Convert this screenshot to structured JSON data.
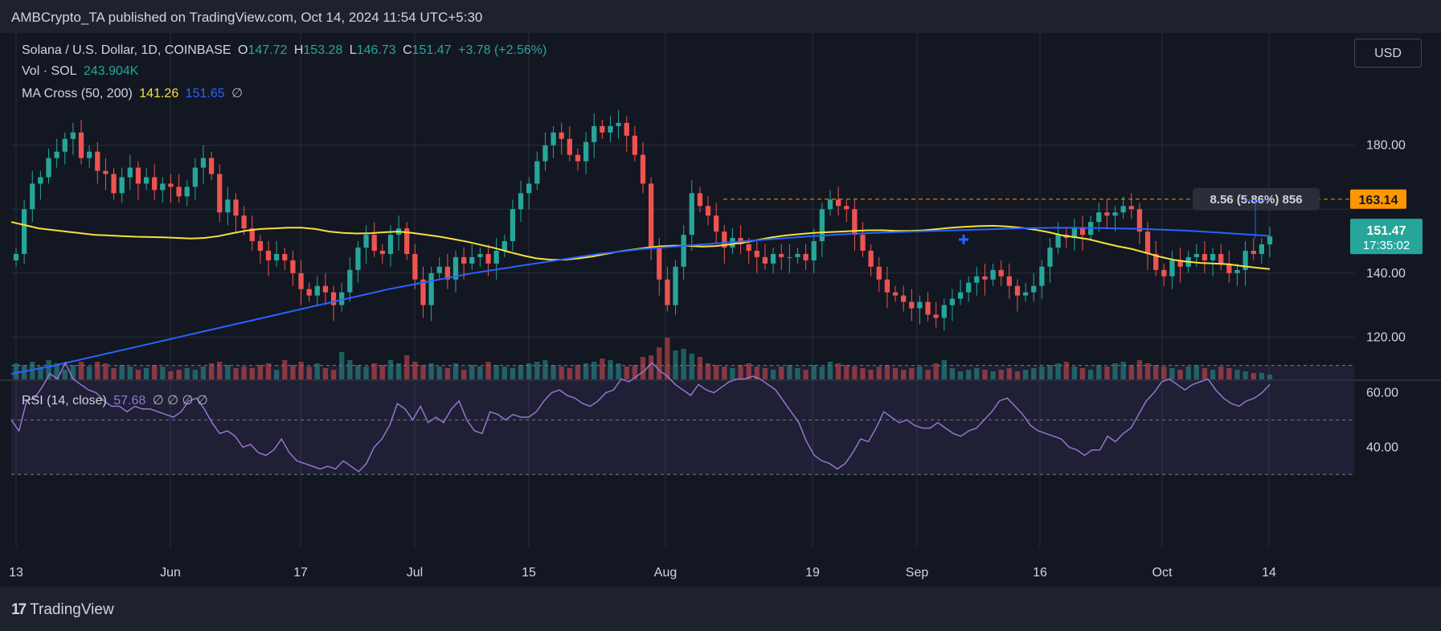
{
  "header": {
    "publish_text": "AMBCrypto_TA published on TradingView.com, Oct 14, 2024 11:54 UTC+5:30"
  },
  "legend": {
    "symbol": "Solana / U.S. Dollar, 1D, COINBASE",
    "o_label": "O",
    "o_value": "147.72",
    "h_label": "H",
    "h_value": "153.28",
    "l_label": "L",
    "l_value": "146.73",
    "c_label": "C",
    "c_value": "151.47",
    "change": "+3.78 (+2.56%)",
    "vol_label": "Vol · SOL",
    "vol_value": "243.904K",
    "ma_label": "MA Cross (50, 200)",
    "ma50_value": "141.26",
    "ma200_value": "151.65",
    "ma_extra": "∅",
    "rsi_label": "RSI (14, close)",
    "rsi_value": "57.68",
    "rsi_extra": "∅ ∅ ∅ ∅"
  },
  "currency_button": "USD",
  "footer": {
    "brand": "TradingView",
    "mark": "17"
  },
  "colors": {
    "up": "#26a69a",
    "down": "#ef5350",
    "ma50": "#f5e13d",
    "ma200": "#2962ff",
    "rsi": "#9575cd",
    "bg": "#131722",
    "price_tag": "#26a69a",
    "level_tag": "#ff9800"
  },
  "chart_data": {
    "type": "candlestick",
    "price_axis": {
      "ticks": [
        120,
        140,
        160,
        180
      ],
      "tick_labels": [
        "120.00",
        "140.00",
        "",
        "180.00"
      ],
      "range": [
        106,
        192
      ]
    },
    "time_axis": {
      "labels": [
        "13",
        "Jun",
        "17",
        "Jul",
        "15",
        "Aug",
        "19",
        "Sep",
        "16",
        "Oct",
        "14"
      ]
    },
    "last_price": {
      "value": 151.47,
      "label": "151.47",
      "countdown": "17:35:02"
    },
    "level_line": {
      "value": 163.14,
      "label": "163.14"
    },
    "measure_label": "8.56 (5.86%) 856",
    "ohlc_closes": [
      146,
      160,
      168,
      170,
      176,
      178,
      182,
      184,
      176,
      178,
      172,
      171,
      165,
      170,
      173,
      168,
      170,
      166,
      168,
      167,
      164,
      167,
      173,
      176,
      171,
      159,
      163,
      158,
      154,
      150,
      147,
      144,
      146,
      144,
      140,
      135,
      133,
      136,
      134,
      130,
      134,
      141,
      148,
      152,
      147,
      146,
      152,
      154,
      146,
      138,
      130,
      140,
      142,
      138,
      145,
      143,
      145,
      146,
      143,
      147,
      150,
      160,
      165,
      168,
      175,
      180,
      184,
      182,
      177,
      175,
      181,
      186,
      184,
      186,
      187,
      183,
      177,
      168,
      148,
      138,
      130,
      142,
      152,
      165,
      161,
      158,
      153,
      148,
      151,
      149,
      147,
      145,
      143,
      146,
      145,
      145,
      146,
      144,
      150,
      160,
      163,
      161,
      160,
      152,
      147,
      142,
      138,
      134,
      133,
      131,
      129,
      131,
      127,
      126,
      130,
      132,
      134,
      137,
      139,
      138,
      141,
      139,
      136,
      133,
      134,
      136,
      142,
      148,
      152,
      151,
      154,
      152,
      156,
      159,
      158,
      159,
      161,
      160,
      153,
      146,
      141,
      139,
      144,
      142,
      145,
      146,
      144,
      146,
      143,
      140,
      141,
      147,
      146,
      149,
      151.47
    ],
    "volumes": [
      20,
      18,
      22,
      16,
      24,
      20,
      12,
      18,
      22,
      16,
      22,
      20,
      14,
      18,
      16,
      12,
      14,
      18,
      16,
      10,
      12,
      14,
      12,
      16,
      20,
      22,
      18,
      14,
      16,
      14,
      18,
      20,
      12,
      24,
      18,
      22,
      16,
      20,
      14,
      12,
      34,
      24,
      18,
      16,
      20,
      18,
      24,
      20,
      30,
      22,
      18,
      20,
      16,
      14,
      20,
      12,
      18,
      16,
      22,
      18,
      16,
      14,
      18,
      20,
      22,
      24,
      18,
      16,
      14,
      18,
      20,
      22,
      26,
      24,
      20,
      16,
      18,
      28,
      30,
      40,
      52,
      36,
      38,
      32,
      28,
      20,
      18,
      16,
      14,
      18,
      20,
      16,
      14,
      12,
      16,
      18,
      14,
      12,
      18,
      16,
      22,
      20,
      18,
      16,
      14,
      12,
      16,
      18,
      14,
      12,
      14,
      16,
      12,
      20,
      24,
      14,
      10,
      12,
      14,
      12,
      10,
      12,
      14,
      10,
      12,
      14,
      16,
      18,
      20,
      22,
      16,
      14,
      12,
      18,
      16,
      20,
      22,
      18,
      24,
      20,
      18,
      16,
      14,
      12,
      16,
      18,
      14,
      12,
      16,
      14,
      12,
      10,
      8,
      8,
      6
    ],
    "ma50": [
      156,
      155,
      154,
      153.5,
      153,
      152.5,
      152,
      151.8,
      151.6,
      151.4,
      151.3,
      151.2,
      151,
      150.8,
      151,
      151.6,
      152.5,
      153.3,
      153.8,
      154,
      154.2,
      154.2,
      153.8,
      153,
      152.6,
      152.4,
      152.5,
      152.8,
      153,
      152.6,
      152,
      151.4,
      150.6,
      149.8,
      148.8,
      147.8,
      146.6,
      145.5,
      144.6,
      144.2,
      144.2,
      144.6,
      145.2,
      146,
      146.8,
      147.4,
      148,
      148.4,
      148.6,
      148.5,
      148.3,
      148.5,
      149,
      149.6,
      150.4,
      151.2,
      151.8,
      152.2,
      152.6,
      152.8,
      153,
      153.2,
      153.4,
      153.4,
      153.2,
      153.2,
      153.4,
      153.8,
      154.2,
      154.5,
      154.7,
      154.8,
      154.6,
      154.2,
      153.6,
      152.8,
      151.8,
      151.2,
      150.5,
      149.4,
      148.4,
      147.6,
      146.4,
      145.2,
      144.2,
      143.6,
      143.2,
      143,
      142.8,
      142.2,
      141.7,
      141.26
    ],
    "ma200": [
      108.5,
      111,
      114,
      117,
      120,
      123,
      126,
      129,
      132,
      135,
      137.5,
      140,
      142,
      144,
      146,
      147.5,
      148.5,
      149.5,
      150.5,
      151.5,
      152.3,
      152.8,
      153.2,
      153.6,
      154,
      154.2,
      154.1,
      153.8,
      153.3,
      152.5,
      151.65
    ],
    "rsi_axis": {
      "ticks": [
        40,
        60
      ],
      "tick_labels": [
        "40.00",
        "60.00"
      ],
      "bands": [
        30,
        50,
        70
      ],
      "range": [
        28,
        74
      ]
    },
    "rsi": [
      50,
      46,
      57,
      58,
      62,
      67,
      65,
      71,
      65,
      63,
      61,
      60,
      57,
      55,
      55,
      53,
      55,
      54,
      54,
      53,
      52,
      51,
      53,
      57,
      58,
      54,
      49,
      45,
      46,
      44,
      40,
      41,
      38,
      37,
      39,
      43,
      38,
      35,
      34,
      33,
      32,
      33,
      32,
      35,
      33,
      31,
      34,
      40,
      43,
      48,
      56,
      54,
      50,
      55,
      49,
      51,
      49,
      54,
      57,
      50,
      46,
      45,
      53,
      52,
      50,
      52,
      51,
      51,
      53,
      57,
      60,
      61,
      59,
      58,
      56,
      55,
      57,
      60,
      61,
      65,
      64,
      66,
      68,
      71,
      68,
      66,
      63,
      61,
      59,
      63,
      61,
      60,
      62,
      64,
      65,
      65,
      66,
      65,
      63,
      61,
      57,
      53,
      49,
      42,
      37,
      35,
      34,
      32,
      34,
      38,
      43,
      42,
      47,
      53,
      51,
      49,
      50,
      48,
      47,
      47,
      49,
      47,
      45,
      44,
      46,
      47,
      50,
      53,
      57,
      58,
      55,
      52,
      48,
      46,
      45,
      44,
      43,
      40,
      39,
      37,
      39,
      39,
      44,
      42,
      45,
      47,
      52,
      57,
      60,
      64,
      65,
      63,
      61,
      63,
      64,
      65,
      61,
      58,
      56,
      55,
      57,
      58,
      60,
      63
    ],
    "volume_label": "243.904K"
  }
}
